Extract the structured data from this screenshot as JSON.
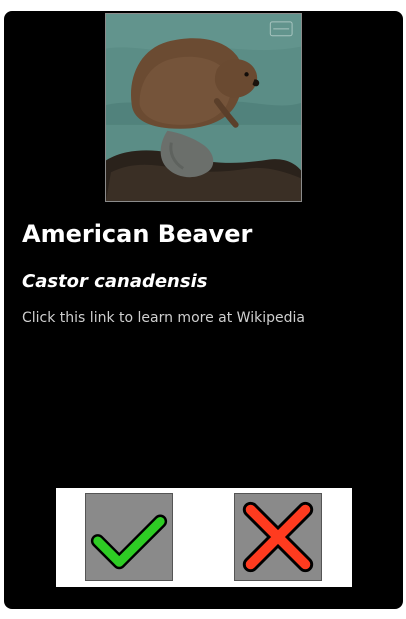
{
  "card": {
    "title": "American Beaver",
    "scientific_name": "Castor canadensis",
    "link_text": "Click this link to learn more at Wikipedia"
  },
  "image": {
    "subject": "beaver on rock by water",
    "alt": "American Beaver"
  },
  "actions": {
    "accept_icon": "check-icon",
    "reject_icon": "x-icon",
    "accept_color": "#2ecc24",
    "reject_color": "#ff3b1f"
  }
}
